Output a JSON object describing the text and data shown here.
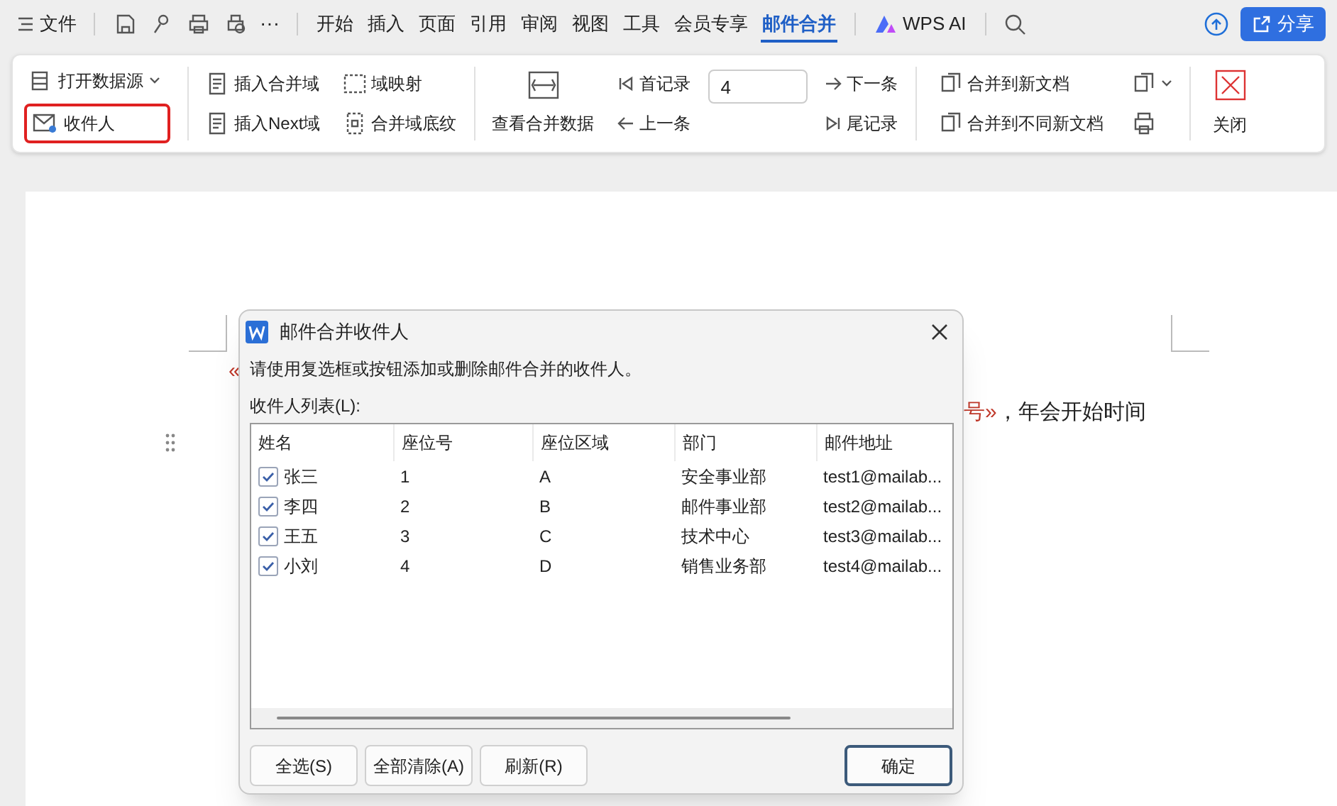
{
  "menu": {
    "label": "文件"
  },
  "more": "···",
  "tabs": [
    {
      "label": "开始",
      "selected": false
    },
    {
      "label": "插入",
      "selected": false
    },
    {
      "label": "页面",
      "selected": false
    },
    {
      "label": "引用",
      "selected": false
    },
    {
      "label": "审阅",
      "selected": false
    },
    {
      "label": "视图",
      "selected": false
    },
    {
      "label": "工具",
      "selected": false
    },
    {
      "label": "会员专享",
      "selected": false
    },
    {
      "label": "邮件合并",
      "selected": true
    },
    {
      "label": "WPS AI",
      "selected": false,
      "kind": "ai"
    }
  ],
  "share_button": "分享",
  "ribbon": {
    "open_data_source": "打开数据源",
    "recipients": {
      "label": "收件人",
      "highlighted": true
    },
    "insert_merge_field": "插入合并域",
    "insert_next_field": "插入Next域",
    "field_mapping": "域映射",
    "field_shading": "合并域底纹",
    "view_merged_data": "查看合并数据",
    "first_record": "首记录",
    "previous_record": "上一条",
    "record_field": {
      "value": "4"
    },
    "next_record": "下一条",
    "last_record": "尾记录",
    "merge_to_new_document": "合并到新文档",
    "merge_to_separate_documents": "合并到不同新文档",
    "close": "关闭"
  },
  "document": {
    "line_1": [
      {
        "text": "«",
        "kind": "field"
      }
    ],
    "line_2": [
      {
        "text": "号»",
        "kind": "field"
      },
      {
        "text": "，年会开始时间",
        "kind": "plain"
      }
    ]
  },
  "dialog": {
    "title": "邮件合并收件人",
    "instruction": "请使用复选框或按钮添加或删除邮件合并的收件人。",
    "list_label": "收件人列表(L):",
    "columns": [
      "姓名",
      "座位号",
      "座位区域",
      "部门",
      "邮件地址"
    ],
    "rows": [
      {
        "checked": true,
        "cells": [
          "张三",
          "1",
          "A",
          "安全事业部",
          "test1@mailab..."
        ]
      },
      {
        "checked": true,
        "cells": [
          "李四",
          "2",
          "B",
          "邮件事业部",
          "test2@mailab..."
        ]
      },
      {
        "checked": true,
        "cells": [
          "王五",
          "3",
          "C",
          "技术中心",
          "test3@mailab..."
        ]
      },
      {
        "checked": true,
        "cells": [
          "小刘",
          "4",
          "D",
          "销售业务部",
          "test4@mailab..."
        ]
      }
    ],
    "buttons": [
      {
        "label": "全选(S)",
        "default": false
      },
      {
        "label": "全部清除(A)",
        "default": false
      },
      {
        "label": "刷新(R)",
        "default": false
      },
      {
        "label": "确定",
        "default": true
      }
    ]
  }
}
